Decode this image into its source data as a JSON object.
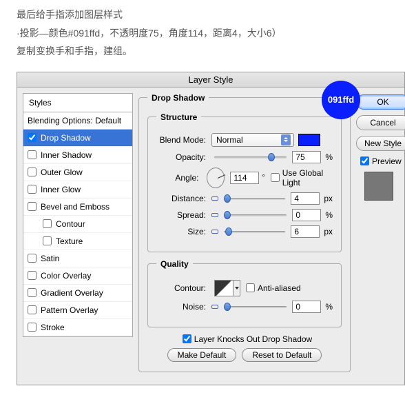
{
  "instructions": {
    "line1": "最后给手指添加图层样式",
    "line2": "·投影—颜色#091ffd，不透明度75，角度114，距离4，大小6）",
    "line3": "复制变换手和手指，建组。"
  },
  "dialog": {
    "title": "Layer Style",
    "badge": "091ffd",
    "styles_header": "Styles",
    "styles": {
      "blending_options": "Blending Options: Default",
      "drop_shadow": "Drop Shadow",
      "inner_shadow": "Inner Shadow",
      "outer_glow": "Outer Glow",
      "inner_glow": "Inner Glow",
      "bevel_emboss": "Bevel and Emboss",
      "contour": "Contour",
      "texture": "Texture",
      "satin": "Satin",
      "color_overlay": "Color Overlay",
      "gradient_overlay": "Gradient Overlay",
      "pattern_overlay": "Pattern Overlay",
      "stroke": "Stroke"
    },
    "structure": {
      "legend_outer": "Drop Shadow",
      "legend_inner": "Structure",
      "blend_mode_label": "Blend Mode:",
      "blend_mode_value": "Normal",
      "opacity_label": "Opacity:",
      "opacity_value": "75",
      "opacity_unit": "%",
      "angle_label": "Angle:",
      "angle_value": "114",
      "angle_degree": "°",
      "use_global": "Use Global Light",
      "distance_label": "Distance:",
      "distance_value": "4",
      "distance_unit": "px",
      "spread_label": "Spread:",
      "spread_value": "0",
      "spread_unit": "%",
      "size_label": "Size:",
      "size_value": "6",
      "size_unit": "px"
    },
    "quality": {
      "legend": "Quality",
      "contour_label": "Contour:",
      "anti_aliased": "Anti-aliased",
      "noise_label": "Noise:",
      "noise_value": "0",
      "noise_unit": "%"
    },
    "knocks_out": "Layer Knocks Out Drop Shadow",
    "make_default": "Make Default",
    "reset_default": "Reset to Default",
    "buttons": {
      "ok": "OK",
      "cancel": "Cancel",
      "new_style": "New Style",
      "preview": "Preview"
    }
  }
}
